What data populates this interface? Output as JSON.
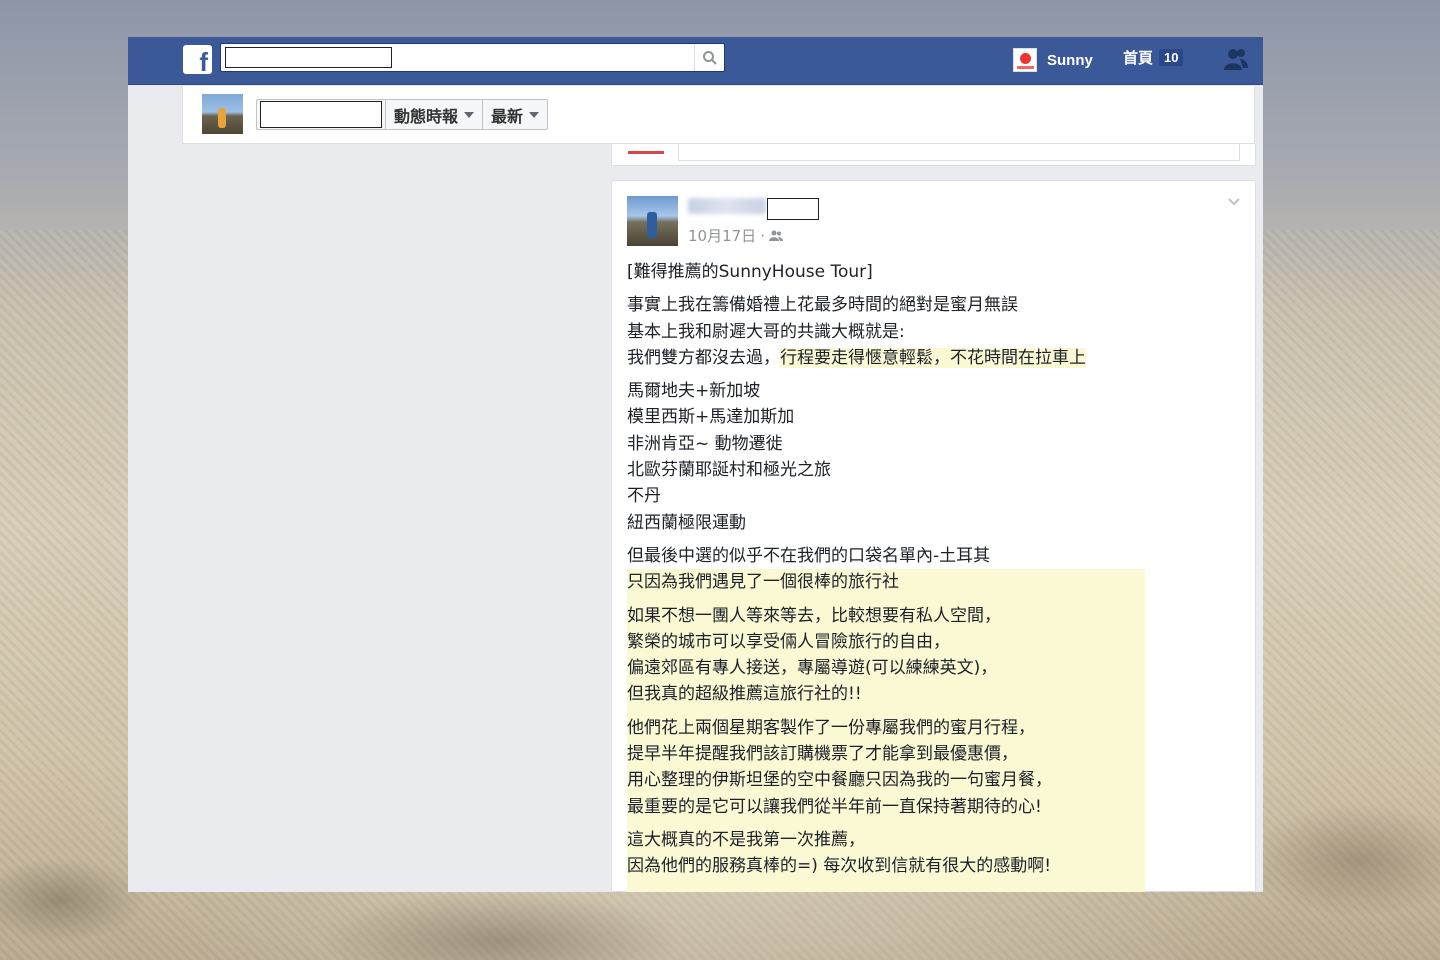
{
  "topbar": {
    "brand": "f",
    "user_name": "Sunny",
    "home_label": "首頁",
    "home_count": "10",
    "search_icon": "search-icon",
    "friends_icon": "friend-requests-icon"
  },
  "subbar": {
    "news_feed_label": "動態時報",
    "sort_label": "最新"
  },
  "post": {
    "date": "10月17日",
    "privacy_icon": "friends-audience-icon",
    "title": "[難得推薦的SunnyHouse Tour]",
    "para1": [
      "事實上我在籌備婚禮上花最多時間的絕對是蜜月無誤",
      "基本上我和尉遲大哥的共識大概就是:"
    ],
    "para1_last_plain": "我們雙方都沒去過，",
    "para1_last_highlight": "行程要走得愜意輕鬆，不花時間在拉車上",
    "list": [
      "馬爾地夫+新加坡",
      "模里西斯+馬達加斯加",
      "非洲肯亞~ 動物遷徙",
      "北歐芬蘭耶誕村和極光之旅",
      "不丹",
      "紐西蘭極限運動"
    ],
    "para3": [
      "但最後中選的似乎不在我們的口袋名單內-土耳其",
      "只因為我們遇見了一個很棒的旅行社"
    ],
    "para4": [
      "如果不想一團人等來等去，比較想要有私人空間，",
      "繁榮的城市可以享受倆人冒險旅行的自由，",
      "偏遠郊區有專人接送，專屬導遊(可以練練英文)，",
      "但我真的超級推薦這旅行社的!!"
    ],
    "para5": [
      "他們花上兩個星期客製作了一份專屬我們的蜜月行程，",
      "提早半年提醒我們該訂購機票了才能拿到最優惠價，",
      "用心整理的伊斯坦堡的空中餐廳只因為我的一句蜜月餐，",
      "最重要的是它可以讓我們從半年前一直保持著期待的心!"
    ],
    "para6": [
      "這大概真的不是我第一次推薦，",
      "因為他們的服務真棒的=) 每次收到信就有很大的感動啊!"
    ]
  },
  "colors": {
    "facebook_blue": "#3b5998",
    "highlight": "#fbf8d4",
    "feed_background": "#e9ebee"
  }
}
